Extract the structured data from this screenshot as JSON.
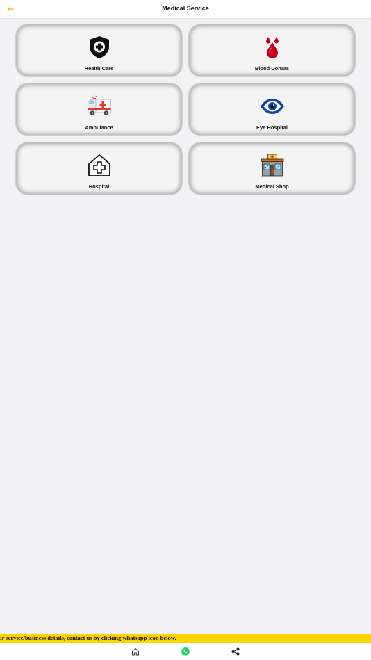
{
  "header": {
    "title": "Medical Service",
    "back_icon": "arrow-left-icon",
    "accent_color": "#f5b301"
  },
  "services": [
    {
      "label": "Health Care",
      "icon": "shield-plus-icon"
    },
    {
      "label": "Blood Donars",
      "icon": "blood-drops-icon"
    },
    {
      "label": "Ambulance",
      "icon": "ambulance-icon"
    },
    {
      "label": "Eye Hospital",
      "icon": "eye-icon"
    },
    {
      "label": "Hospital",
      "icon": "hospital-house-icon"
    },
    {
      "label": "Medical Shop",
      "icon": "medical-shop-icon"
    }
  ],
  "ticker": {
    "text": "ur service/business details, contact us by clicking whatsapp icon below.",
    "background": "#ffd500"
  },
  "bottom_nav": {
    "items": [
      {
        "icon": "home-icon"
      },
      {
        "icon": "whatsapp-icon",
        "color": "#25d366"
      },
      {
        "icon": "share-icon"
      }
    ]
  }
}
